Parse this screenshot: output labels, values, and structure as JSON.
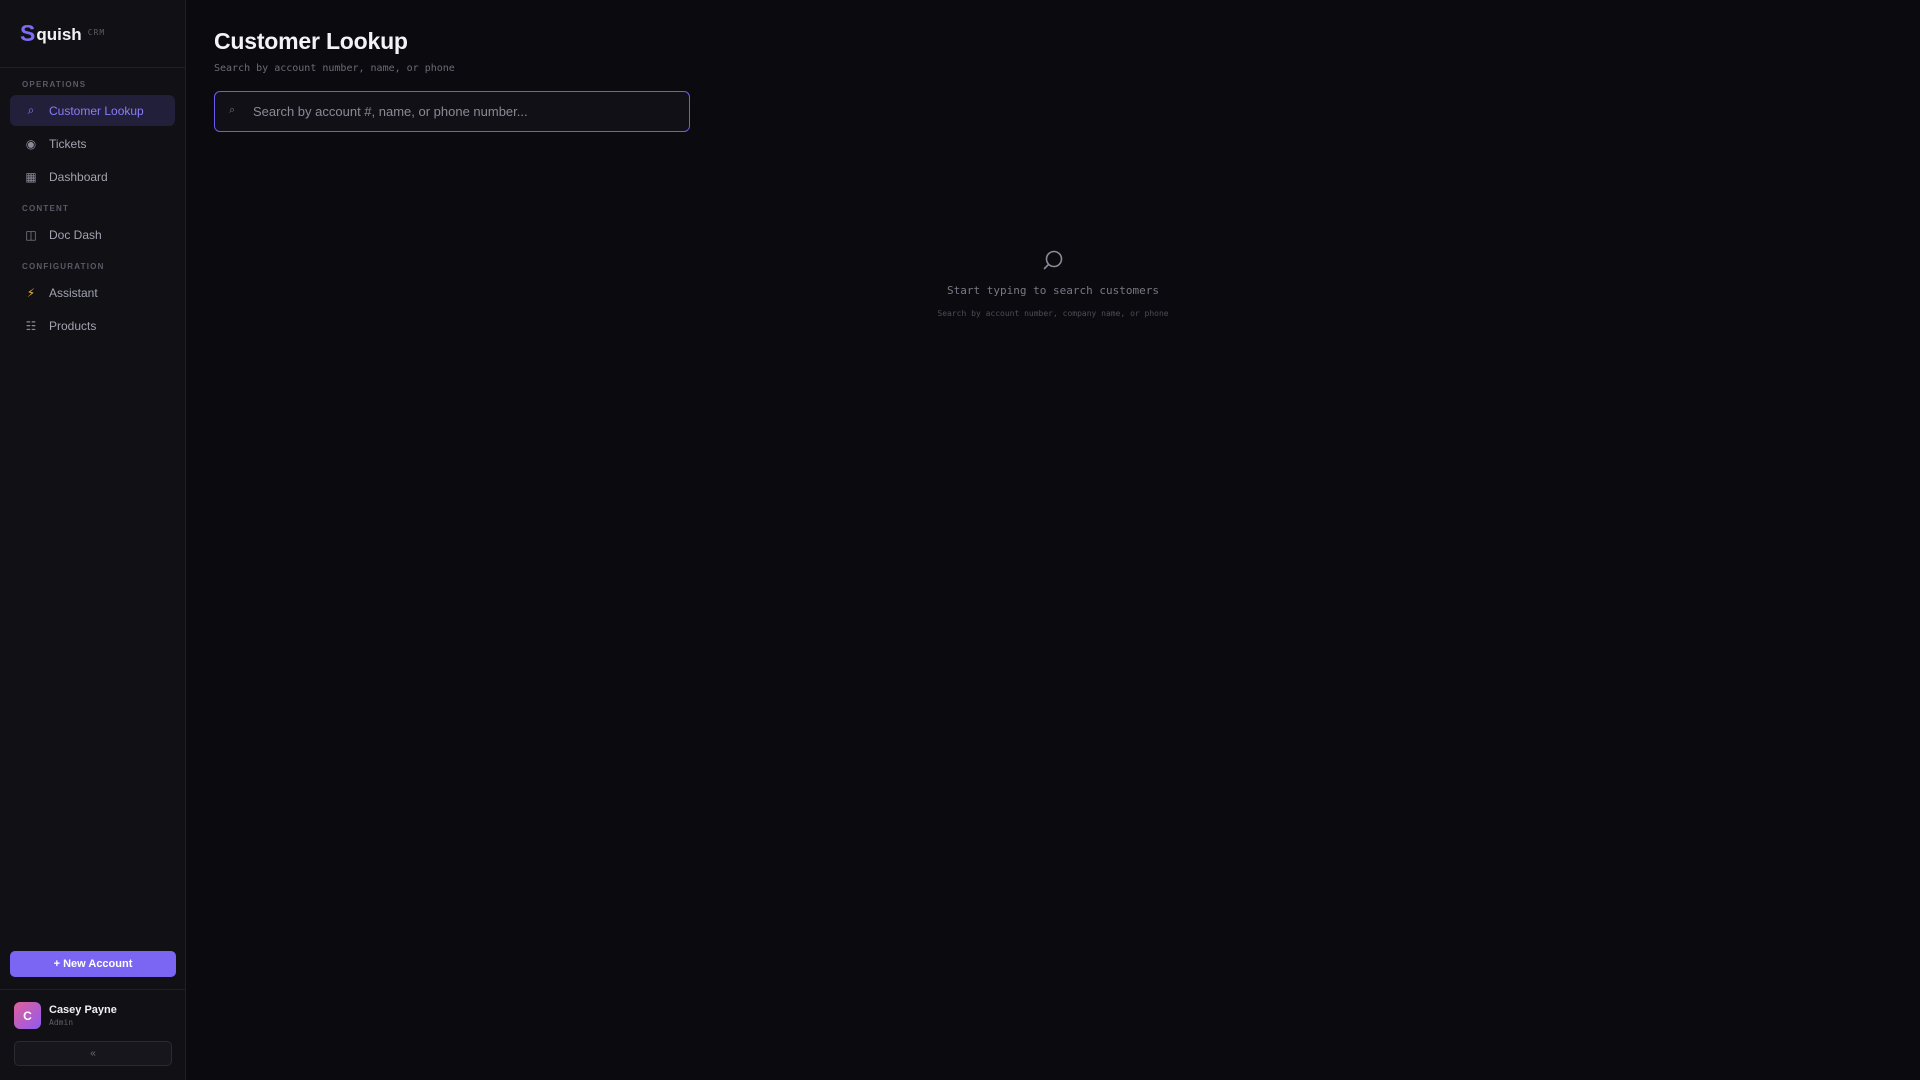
{
  "brand": {
    "initial": "S",
    "name": "quish",
    "tag": "CRM"
  },
  "sidebar": {
    "sections": [
      {
        "label": "OPERATIONS",
        "items": [
          {
            "label": "Customer Lookup",
            "icon": "search-icon",
            "glyph": "⌕",
            "active": true
          },
          {
            "label": "Tickets",
            "icon": "ticket-icon",
            "glyph": "◉"
          },
          {
            "label": "Dashboard",
            "icon": "dashboard-icon",
            "glyph": "▦"
          }
        ]
      },
      {
        "label": "CONTENT",
        "items": [
          {
            "label": "Doc Dash",
            "icon": "doc-icon",
            "glyph": "◫"
          }
        ]
      },
      {
        "label": "CONFIGURATION",
        "items": [
          {
            "label": "Assistant",
            "icon": "lightning-icon",
            "glyph": "⚡"
          },
          {
            "label": "Products",
            "icon": "list-icon",
            "glyph": "☷"
          }
        ]
      }
    ],
    "new_account_label": "+ New Account",
    "user": {
      "initial": "C",
      "name": "Casey Payne",
      "role": "Admin"
    },
    "collapse_label": "«"
  },
  "main": {
    "title": "Customer Lookup",
    "subtitle": "Search by account number, name, or phone",
    "search": {
      "placeholder": "Search by account #, name, or phone number...",
      "value": ""
    },
    "empty": {
      "title": "Start typing to search customers",
      "subtitle": "Search by account number, company name, or phone"
    }
  },
  "colors": {
    "accent": "#7a66f2",
    "background": "#0b0b0f",
    "sidebar": "#101015"
  }
}
